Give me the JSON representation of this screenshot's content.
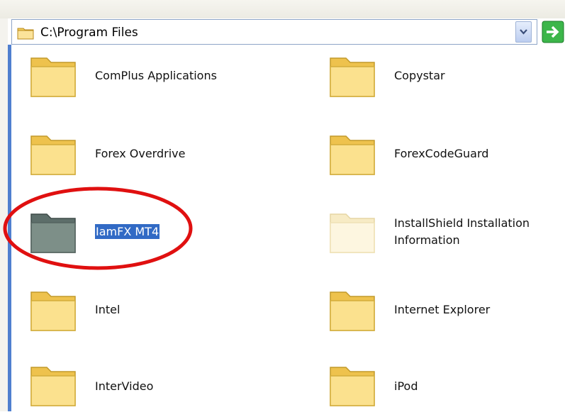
{
  "address": {
    "path": "C:\\Program Files"
  },
  "folders": [
    {
      "name": "ComPlus Applications",
      "state": "normal"
    },
    {
      "name": "Copystar",
      "state": "normal"
    },
    {
      "name": "Forex Overdrive",
      "state": "normal"
    },
    {
      "name": "ForexCodeGuard",
      "state": "normal"
    },
    {
      "name": "IamFX MT4",
      "state": "selected"
    },
    {
      "name": "InstallShield Installation",
      "name_line2": "Information",
      "state": "hidden"
    },
    {
      "name": "Intel",
      "state": "normal"
    },
    {
      "name": "Internet Explorer",
      "state": "normal"
    },
    {
      "name": "InterVideo",
      "state": "normal"
    },
    {
      "name": "iPod",
      "state": "normal"
    }
  ],
  "colors": {
    "selection": "#316ac5",
    "annotation_circle": "#e01010",
    "folder": "#f7d56a",
    "go_arrow": "#2fa83a"
  }
}
